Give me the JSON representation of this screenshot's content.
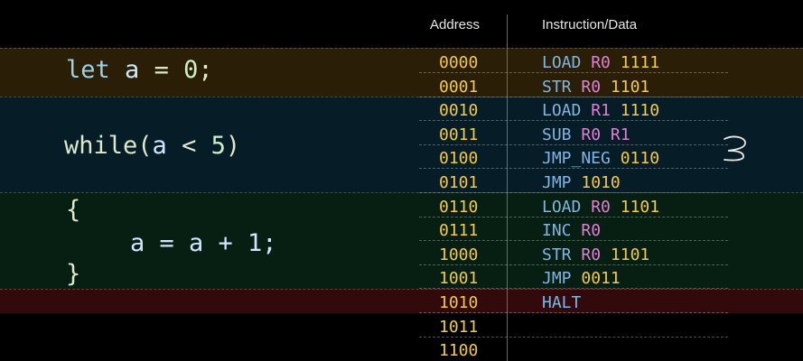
{
  "headers": {
    "address": "Address",
    "instruction": "Instruction/Data"
  },
  "source_code": {
    "line1": {
      "keyword": "let",
      "space1": " ",
      "var": "a",
      "mid": " = ",
      "num": "0",
      "end": ";"
    },
    "line2": {
      "keyword": "while",
      "open": "(",
      "var": "a",
      "mid": " < ",
      "num": "5",
      "close": ")"
    },
    "line3": "{",
    "line4": "a = a + 1;",
    "line5": "}"
  },
  "memory": [
    {
      "address": "0000",
      "parts": [
        {
          "t": "op",
          "v": "LOAD"
        },
        {
          "t": "reg",
          "v": "R0"
        },
        {
          "t": "val",
          "v": "1111"
        }
      ]
    },
    {
      "address": "0001",
      "parts": [
        {
          "t": "op",
          "v": "STR"
        },
        {
          "t": "reg",
          "v": "R0"
        },
        {
          "t": "val",
          "v": "1101"
        }
      ]
    },
    {
      "address": "0010",
      "parts": [
        {
          "t": "op",
          "v": "LOAD"
        },
        {
          "t": "reg",
          "v": "R1"
        },
        {
          "t": "val",
          "v": "1110"
        }
      ]
    },
    {
      "address": "0011",
      "parts": [
        {
          "t": "op",
          "v": "SUB"
        },
        {
          "t": "reg",
          "v": "R0"
        },
        {
          "t": "reg",
          "v": "R1"
        }
      ]
    },
    {
      "address": "0100",
      "parts": [
        {
          "t": "op",
          "v": "JMP_NEG"
        },
        {
          "t": "val",
          "v": "0110"
        }
      ]
    },
    {
      "address": "0101",
      "parts": [
        {
          "t": "op",
          "v": "JMP"
        },
        {
          "t": "val",
          "v": "1010"
        }
      ]
    },
    {
      "address": "0110",
      "parts": [
        {
          "t": "op",
          "v": "LOAD"
        },
        {
          "t": "reg",
          "v": "R0"
        },
        {
          "t": "val",
          "v": "1101"
        }
      ]
    },
    {
      "address": "0111",
      "parts": [
        {
          "t": "op",
          "v": "INC"
        },
        {
          "t": "reg",
          "v": "R0"
        }
      ]
    },
    {
      "address": "1000",
      "parts": [
        {
          "t": "op",
          "v": "STR"
        },
        {
          "t": "reg",
          "v": "R0"
        },
        {
          "t": "val",
          "v": "1101"
        }
      ]
    },
    {
      "address": "1001",
      "parts": [
        {
          "t": "op",
          "v": "JMP"
        },
        {
          "t": "val",
          "v": "0011"
        }
      ]
    },
    {
      "address": "1010",
      "parts": [
        {
          "t": "op",
          "v": "HALT"
        }
      ]
    },
    {
      "address": "1011",
      "parts": []
    },
    {
      "address": "1100",
      "parts": []
    }
  ],
  "colors": {
    "address": "#f2c94c",
    "opcode": "#7fb6e3",
    "register": "#e07fd6",
    "value": "#f2c94c",
    "band_let": "#2a1f06",
    "band_while": "#061c26",
    "band_body": "#071e12",
    "band_halt": "#330a0c"
  }
}
